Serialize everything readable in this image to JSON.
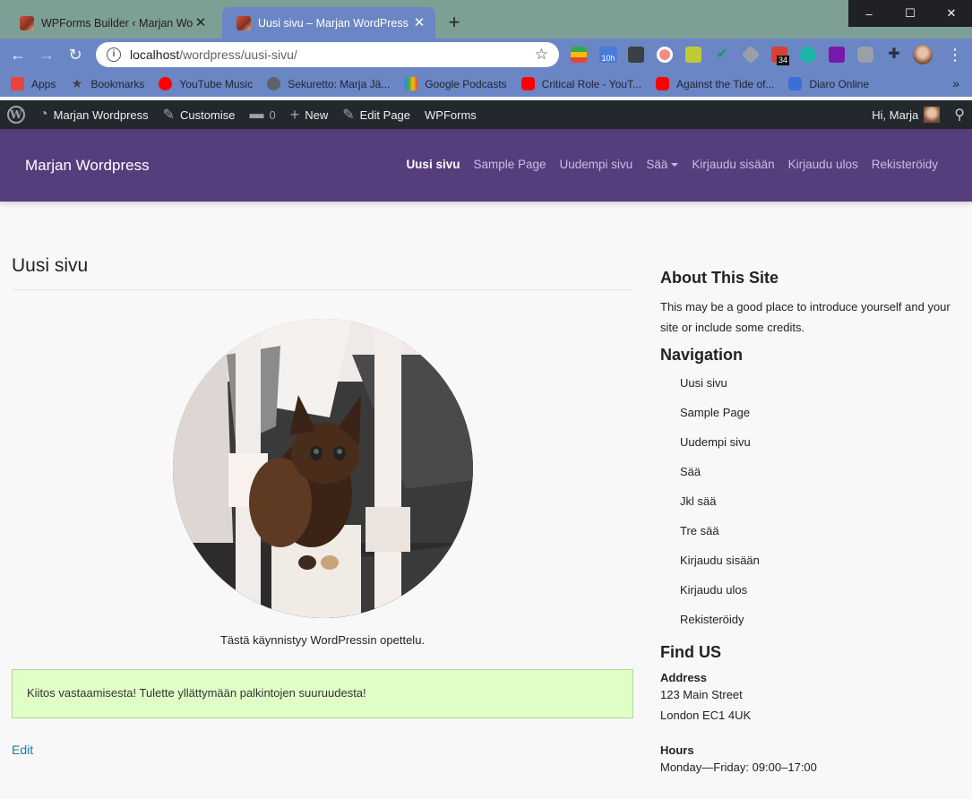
{
  "browser": {
    "tabs": [
      {
        "title": "WPForms Builder ‹ Marjan WordPress",
        "active": false
      },
      {
        "title": "Uusi sivu – Marjan WordPress",
        "active": true
      }
    ],
    "new_tab": "+",
    "window_controls": {
      "minimize": "–",
      "maximize": "☐",
      "close": "✕"
    },
    "nav": {
      "back": "←",
      "forward": "→",
      "reload": "↻"
    },
    "address": {
      "host": "localhost",
      "path": "/wordpress/uusi-sivu/"
    },
    "extension_badges": {
      "calendar": "10h",
      "todoist": "34"
    },
    "bookmarks": [
      {
        "label": "Apps",
        "icon": "apps-icon",
        "color": "#e8453c"
      },
      {
        "label": "Bookmarks",
        "icon": "star-icon",
        "color": "#3c4043"
      },
      {
        "label": "YouTube Music",
        "icon": "youtube-music-icon",
        "color": "#ff0000"
      },
      {
        "label": "Sekuretto: Marja Jä...",
        "icon": "globe-icon",
        "color": "#5f6368"
      },
      {
        "label": "Google Podcasts",
        "icon": "podcasts-icon",
        "color": "#fbbc04"
      },
      {
        "label": "Critical Role - YouT...",
        "icon": "youtube-icon",
        "color": "#ff0000"
      },
      {
        "label": "Against the Tide of...",
        "icon": "youtube-icon",
        "color": "#ff0000"
      },
      {
        "label": "Diaro Online",
        "icon": "diaro-icon",
        "color": "#3b6fd8"
      }
    ],
    "bookmarks_more": "»"
  },
  "admin_bar": {
    "site": "Marjan Wordpress",
    "customise": "Customise",
    "comments_count": "0",
    "new": "New",
    "edit_page": "Edit Page",
    "wpforms": "WPForms",
    "greeting": "Hi, Marja"
  },
  "site": {
    "title": "Marjan Wordpress",
    "nav": [
      {
        "label": "Uusi sivu",
        "current": true
      },
      {
        "label": "Sample Page",
        "current": false
      },
      {
        "label": "Uudempi sivu",
        "current": false
      },
      {
        "label": "Sää",
        "current": false,
        "dropdown": true
      },
      {
        "label": "Kirjaudu sisään",
        "current": false
      },
      {
        "label": "Kirjaudu ulos",
        "current": false
      },
      {
        "label": "Rekisteröidy",
        "current": false
      }
    ]
  },
  "page": {
    "title": "Uusi sivu",
    "image_caption": "Tästä käynnistyy WordPressin opettelu.",
    "notice": "Kiitos vastaamisesta! Tulette yllättymään palkintojen suuruudesta!",
    "edit_link": "Edit"
  },
  "sidebar": {
    "about": {
      "title": "About This Site",
      "text": "This may be a good place to introduce yourself and your site or include some credits."
    },
    "navigation": {
      "title": "Navigation",
      "items": [
        "Uusi sivu",
        "Sample Page",
        "Uudempi sivu",
        "Sää",
        "Jkl sää",
        "Tre sää",
        "Kirjaudu sisään",
        "Kirjaudu ulos",
        "Rekisteröidy"
      ]
    },
    "find_us": {
      "title": "Find US",
      "address_label": "Address",
      "address_line1": "123 Main Street",
      "address_line2": "London EC1 4UK",
      "hours_label": "Hours",
      "hours_line1": "Monday—Friday: 09:00–17:00"
    }
  },
  "colors": {
    "header_bg": "#563d7c",
    "notice_bg": "#e0ffc7",
    "admin_bar_bg": "#23282d",
    "chrome_toolbar": "#6b86c4",
    "link": "#1b7d9a"
  }
}
